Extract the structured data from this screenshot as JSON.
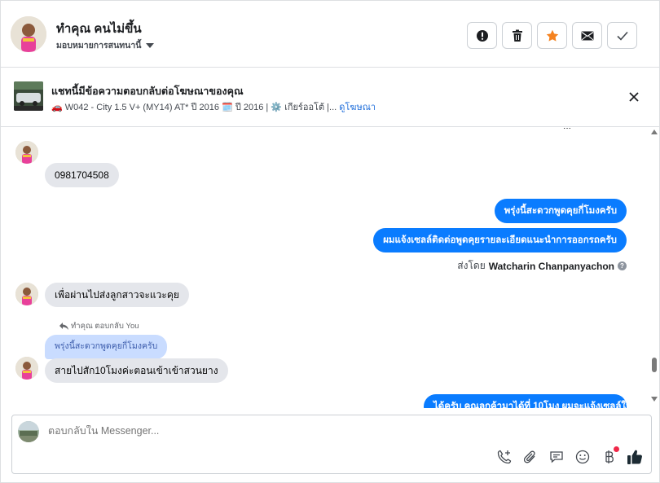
{
  "header": {
    "contact_name": "ทำคุณ คนไม่ขึ้น",
    "assign_label": "มอบหมายการสนทนานี้",
    "actions": [
      {
        "name": "alert-icon"
      },
      {
        "name": "trash-icon"
      },
      {
        "name": "star-icon"
      },
      {
        "name": "envelope-icon"
      },
      {
        "name": "check-icon"
      }
    ]
  },
  "ad": {
    "title": "แชทนี้มีข้อความตอบกลับต่อโฆษณาของคุณ",
    "subtitle": "🚗 W042 - City 1.5 V+ (MY14) AT* ปี 2016 🗓️ ปี 2016 | ⚙️ เกียร์ออโต้ |...",
    "link": "ดูโฆษณา"
  },
  "messages": {
    "partial_top": "...",
    "phone": "0981704508",
    "out1": "พรุ่งนี้สะดวกพูดคุยกี่โมงครับ",
    "out2": "ผมแจ้งเซลล์ติดต่อพูดคุยรายละเอียดแนะนำการออกรถครับ",
    "sent_by_prefix": "ส่งโดย",
    "sent_by_name": "Watcharin Chanpanyachon",
    "in2": "เพื่อผ่านไปส่งลูกสาวจะแวะคุย",
    "reply_meta": "ทำคุณ ตอบกลับ You",
    "quoted": "พรุ่งนี้สะดวกพูดคุยกี่โมงครับ",
    "in3": "สายไปสัก10โมงค่ะตอนเข้าเข้าสวนยาง",
    "out3_partial": "ได้ครับ คุณลูกค้ามาได้ที่ 10โมง ผมจะแจ้งเซลล์ให้ครับ"
  },
  "composer": {
    "placeholder": "ตอบกลับใน Messenger..."
  },
  "colors": {
    "accent": "#0a7cff",
    "incoming_bubble": "#e4e6eb",
    "quote_bubble": "#c9dcff",
    "star": "#f5821f",
    "like": "#1c2b33",
    "notif": "#f02849"
  }
}
